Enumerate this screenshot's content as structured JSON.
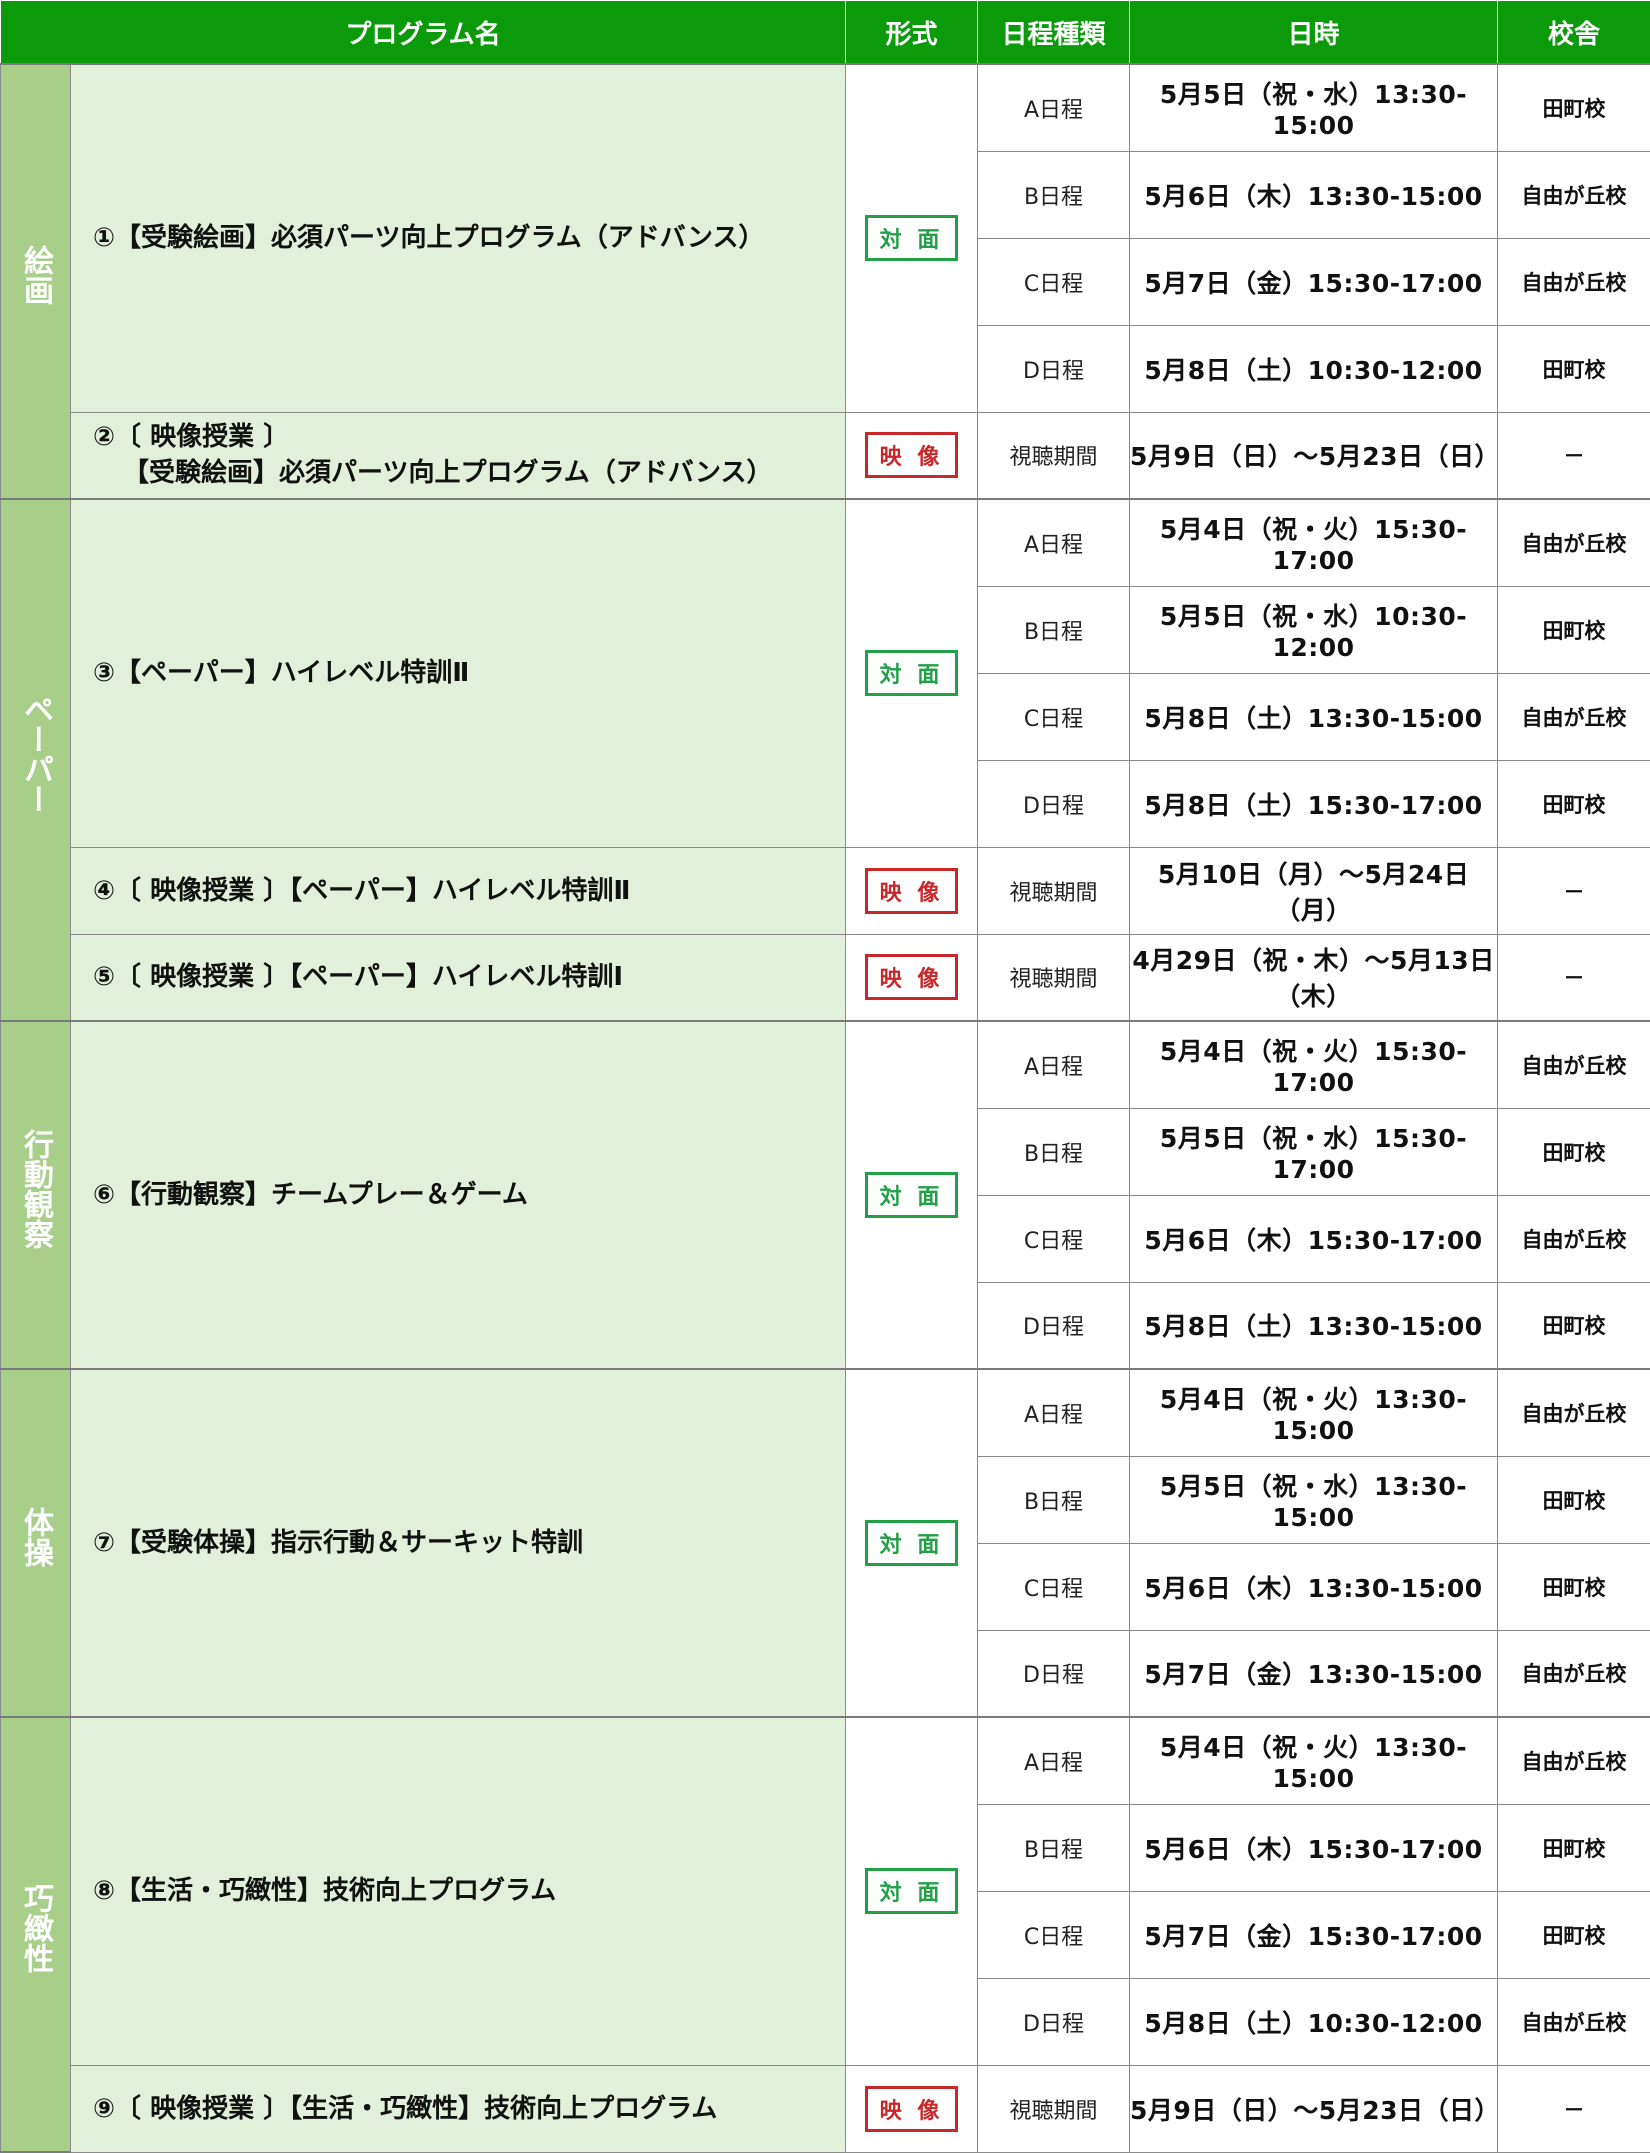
{
  "header": {
    "program": "プログラム名",
    "format": "形式",
    "kind": "日程種類",
    "datetime": "日時",
    "campus": "校舎"
  },
  "badges": {
    "live": "対 面",
    "video": "映 像"
  },
  "categories": [
    "絵画",
    "ペーパー",
    "行動観察",
    "体操",
    "巧緻性"
  ],
  "programs": [
    {
      "name": "①【受験絵画】必須パーツ向上プログラム（アドバンス）",
      "schedules": [
        {
          "kind": "A日程",
          "datetime": "5月5日（祝・水）13:30-15:00",
          "campus": "田町校"
        },
        {
          "kind": "B日程",
          "datetime": "5月6日（木）13:30-15:00",
          "campus": "自由が丘校"
        },
        {
          "kind": "C日程",
          "datetime": "5月7日（金）15:30-17:00",
          "campus": "自由が丘校"
        },
        {
          "kind": "D日程",
          "datetime": "5月8日（土）10:30-12:00",
          "campus": "田町校"
        }
      ]
    },
    {
      "name_line1": "②〔 映像授業 〕",
      "name_line2": "【受験絵画】必須パーツ向上プログラム（アドバンス）",
      "schedules": [
        {
          "kind": "視聴期間",
          "datetime": "5月9日（日）～5月23日（日）",
          "campus": "－"
        }
      ]
    },
    {
      "name": "③【ペーパー】ハイレベル特訓Ⅱ",
      "schedules": [
        {
          "kind": "A日程",
          "datetime": "5月4日（祝・火）15:30-17:00",
          "campus": "自由が丘校"
        },
        {
          "kind": "B日程",
          "datetime": "5月5日（祝・水）10:30-12:00",
          "campus": "田町校"
        },
        {
          "kind": "C日程",
          "datetime": "5月8日（土）13:30-15:00",
          "campus": "自由が丘校"
        },
        {
          "kind": "D日程",
          "datetime": "5月8日（土）15:30-17:00",
          "campus": "田町校"
        }
      ]
    },
    {
      "name": "④〔 映像授業 〕【ペーパー】ハイレベル特訓Ⅱ",
      "schedules": [
        {
          "kind": "視聴期間",
          "datetime": "5月10日（月）～5月24日（月）",
          "campus": "－"
        }
      ]
    },
    {
      "name": "⑤〔 映像授業 〕【ペーパー】ハイレベル特訓Ⅰ",
      "schedules": [
        {
          "kind": "視聴期間",
          "datetime": "4月29日（祝・木）～5月13日（木）",
          "campus": "－"
        }
      ]
    },
    {
      "name": "⑥【行動観察】チームプレー＆ゲーム",
      "schedules": [
        {
          "kind": "A日程",
          "datetime": "5月4日（祝・火）15:30-17:00",
          "campus": "自由が丘校"
        },
        {
          "kind": "B日程",
          "datetime": "5月5日（祝・水）15:30-17:00",
          "campus": "田町校"
        },
        {
          "kind": "C日程",
          "datetime": "5月6日（木）15:30-17:00",
          "campus": "自由が丘校"
        },
        {
          "kind": "D日程",
          "datetime": "5月8日（土）13:30-15:00",
          "campus": "田町校"
        }
      ]
    },
    {
      "name": "⑦【受験体操】指示行動＆サーキット特訓",
      "schedules": [
        {
          "kind": "A日程",
          "datetime": "5月4日（祝・火）13:30-15:00",
          "campus": "自由が丘校"
        },
        {
          "kind": "B日程",
          "datetime": "5月5日（祝・水）13:30-15:00",
          "campus": "田町校"
        },
        {
          "kind": "C日程",
          "datetime": "5月6日（木）13:30-15:00",
          "campus": "田町校"
        },
        {
          "kind": "D日程",
          "datetime": "5月7日（金）13:30-15:00",
          "campus": "自由が丘校"
        }
      ]
    },
    {
      "name": "⑧【生活・巧緻性】技術向上プログラム",
      "schedules": [
        {
          "kind": "A日程",
          "datetime": "5月4日（祝・火）13:30-15:00",
          "campus": "自由が丘校"
        },
        {
          "kind": "B日程",
          "datetime": "5月6日（木）15:30-17:00",
          "campus": "田町校"
        },
        {
          "kind": "C日程",
          "datetime": "5月7日（金）15:30-17:00",
          "campus": "田町校"
        },
        {
          "kind": "D日程",
          "datetime": "5月8日（土）10:30-12:00",
          "campus": "自由が丘校"
        }
      ]
    },
    {
      "name": "⑨〔 映像授業 〕【生活・巧緻性】技術向上プログラム",
      "schedules": [
        {
          "kind": "視聴期間",
          "datetime": "5月9日（日）～5月23日（日）",
          "campus": "－"
        }
      ]
    }
  ]
}
